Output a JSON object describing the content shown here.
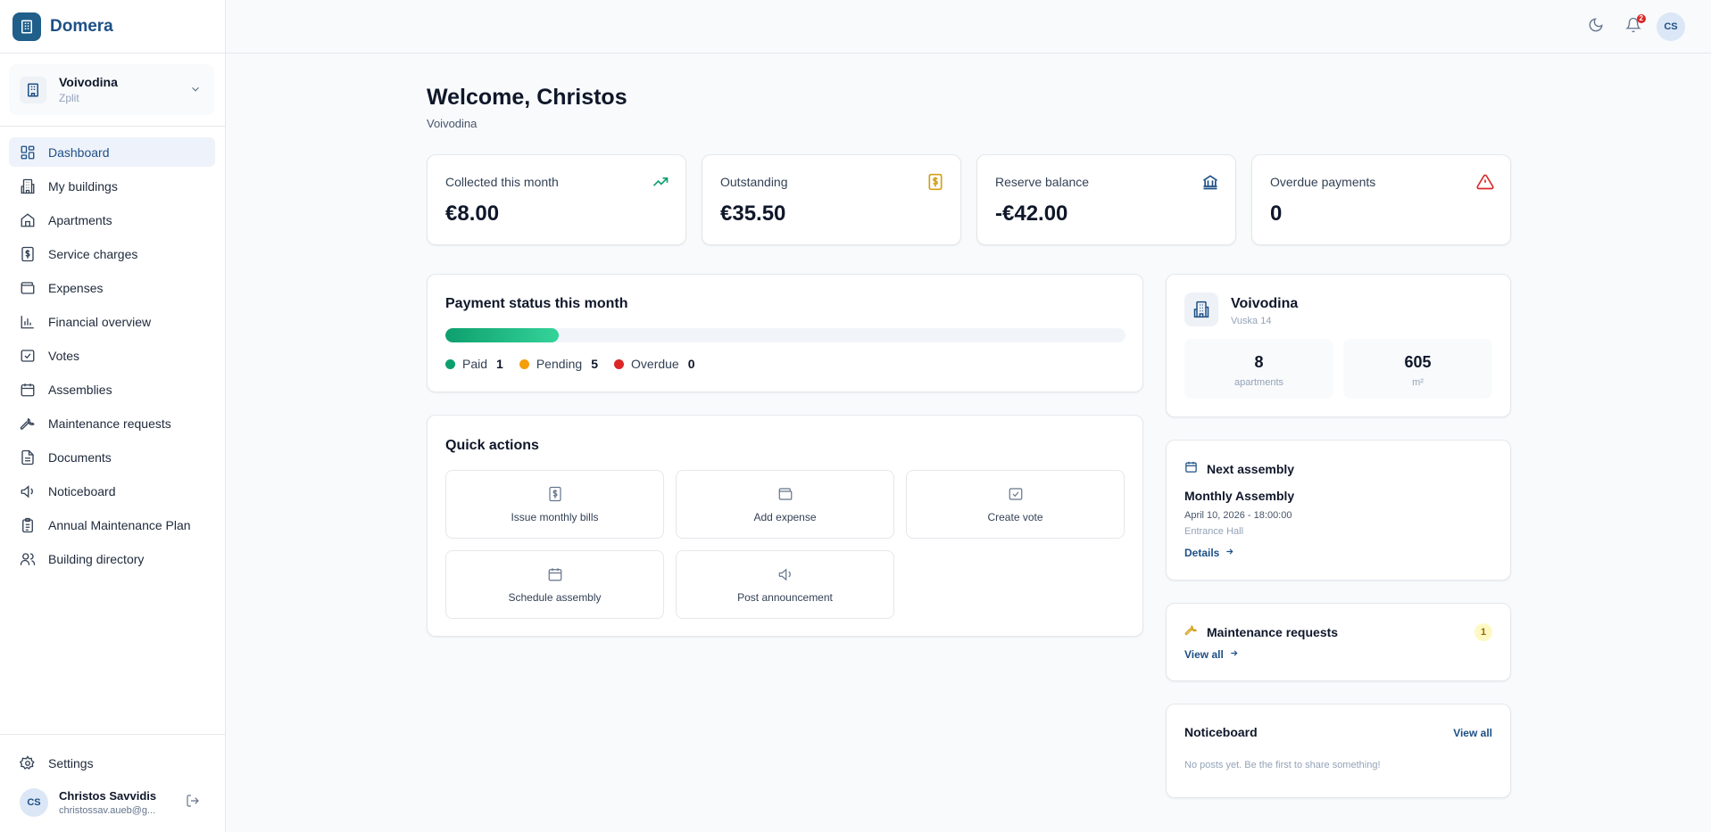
{
  "app": {
    "name": "Domera"
  },
  "org": {
    "name": "Voivodina",
    "sub": "Zplit"
  },
  "nav": [
    {
      "label": "Dashboard",
      "icon": "dashboard-icon",
      "active": true
    },
    {
      "label": "My buildings",
      "icon": "buildings-icon"
    },
    {
      "label": "Apartments",
      "icon": "home-icon"
    },
    {
      "label": "Service charges",
      "icon": "dollar-receipt-icon"
    },
    {
      "label": "Expenses",
      "icon": "wallet-icon"
    },
    {
      "label": "Financial overview",
      "icon": "bar-chart-icon"
    },
    {
      "label": "Votes",
      "icon": "vote-icon"
    },
    {
      "label": "Assemblies",
      "icon": "calendar-icon"
    },
    {
      "label": "Maintenance requests",
      "icon": "wrench-icon"
    },
    {
      "label": "Documents",
      "icon": "document-icon"
    },
    {
      "label": "Noticeboard",
      "icon": "megaphone-icon"
    },
    {
      "label": "Annual Maintenance Plan",
      "icon": "clipboard-icon"
    },
    {
      "label": "Building directory",
      "icon": "users-icon"
    }
  ],
  "settings": {
    "label": "Settings"
  },
  "user": {
    "initials": "CS",
    "name": "Christos Savvidis",
    "email": "christossav.aueb@g..."
  },
  "topbar": {
    "notifications_count": "2",
    "avatar_initials": "CS"
  },
  "welcome": {
    "title": "Welcome, Christos",
    "subtitle": "Voivodina"
  },
  "stats": [
    {
      "label": "Collected this month",
      "value": "€8.00",
      "icon": "trending-up-icon",
      "color": "#0e9f6e"
    },
    {
      "label": "Outstanding",
      "value": "€35.50",
      "icon": "dollar-receipt-icon",
      "color": "#d4a017"
    },
    {
      "label": "Reserve balance",
      "value": "-€42.00",
      "icon": "bank-icon",
      "color": "#1d4f85"
    },
    {
      "label": "Overdue payments",
      "value": "0",
      "icon": "alert-triangle-icon",
      "color": "#dc2626"
    }
  ],
  "payment_status": {
    "title": "Payment status this month",
    "paid_fraction": 0.167,
    "legend": [
      {
        "label": "Paid",
        "count": "1",
        "color": "#0e9f6e"
      },
      {
        "label": "Pending",
        "count": "5",
        "color": "#f59e0b"
      },
      {
        "label": "Overdue",
        "count": "0",
        "color": "#dc2626"
      }
    ]
  },
  "quick_actions": {
    "title": "Quick actions",
    "items": [
      {
        "label": "Issue monthly bills",
        "icon": "dollar-receipt-icon"
      },
      {
        "label": "Add expense",
        "icon": "wallet-icon"
      },
      {
        "label": "Create vote",
        "icon": "vote-icon"
      },
      {
        "label": "Schedule assembly",
        "icon": "calendar-icon"
      },
      {
        "label": "Post announcement",
        "icon": "megaphone-icon"
      }
    ]
  },
  "building": {
    "name": "Voivodina",
    "address": "Vuska 14",
    "apartments_value": "8",
    "apartments_label": "apartments",
    "area_value": "605",
    "area_label": "m²"
  },
  "next_assembly": {
    "title": "Next assembly",
    "name": "Monthly Assembly",
    "datetime": "April 10, 2026 - 18:00:00",
    "location": "Entrance Hall",
    "link": "Details"
  },
  "maintenance": {
    "title": "Maintenance requests",
    "count": "1",
    "link": "View all"
  },
  "noticeboard": {
    "title": "Noticeboard",
    "link": "View all",
    "empty": "No posts yet. Be the first to share something!"
  }
}
